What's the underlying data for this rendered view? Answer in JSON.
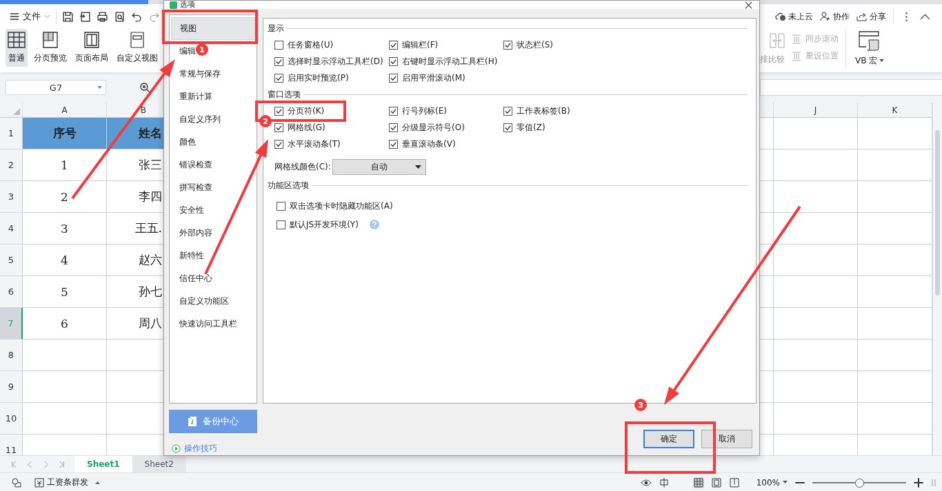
{
  "app": {
    "menu": "文件",
    "view_buttons": [
      {
        "label": "普通",
        "selected": true
      },
      {
        "label": "分页预览",
        "selected": false
      },
      {
        "label": "页面布局",
        "selected": false
      },
      {
        "label": "自定义视图",
        "selected": false
      }
    ],
    "right_actions": [
      {
        "label": "未上云"
      },
      {
        "label": "协作"
      },
      {
        "label": "分享"
      }
    ],
    "compare": "排比较",
    "sync_items": [
      {
        "label": "同步滚动",
        "disabled": true
      },
      {
        "label": "重设位置",
        "disabled": true
      }
    ],
    "macro": "VB 宏"
  },
  "formula_bar": {
    "name_box": "G7"
  },
  "sheet": {
    "left_columns": [
      "A",
      "B"
    ],
    "right_columns": [
      "J",
      "K"
    ],
    "rows": [
      {
        "number": "1",
        "selected": false,
        "kind": "header",
        "cells": [
          "序号",
          "姓名"
        ]
      },
      {
        "number": "2",
        "selected": false,
        "kind": "data",
        "cells": [
          "1",
          "张三"
        ]
      },
      {
        "number": "3",
        "selected": false,
        "kind": "data",
        "cells": [
          "2",
          "李四"
        ]
      },
      {
        "number": "4",
        "selected": false,
        "kind": "data",
        "cells": [
          "3",
          "王五."
        ]
      },
      {
        "number": "5",
        "selected": false,
        "kind": "data",
        "cells": [
          "4",
          "赵六"
        ]
      },
      {
        "number": "6",
        "selected": false,
        "kind": "data",
        "cells": [
          "5",
          "孙七"
        ]
      },
      {
        "number": "7",
        "selected": true,
        "kind": "data",
        "cells": [
          "6",
          "周八"
        ]
      },
      {
        "number": "8",
        "selected": false,
        "kind": "empty"
      },
      {
        "number": "9",
        "selected": false,
        "kind": "empty"
      },
      {
        "number": "10",
        "selected": false,
        "kind": "empty"
      },
      {
        "number": "11",
        "selected": false,
        "kind": "empty"
      }
    ]
  },
  "sheet_tabs": [
    {
      "label": "Sheet1",
      "selected": true
    },
    {
      "label": "Sheet2",
      "selected": false
    }
  ],
  "status_bar": {
    "label": "工资条群发",
    "zoom": "100%",
    "level": 0.5
  },
  "dialog": {
    "title": "选项",
    "nav": [
      {
        "label": "视图",
        "selected": true
      },
      {
        "label": "编辑",
        "selected": false
      },
      {
        "label": "常规与保存",
        "selected": false
      },
      {
        "label": "重新计算",
        "selected": false
      },
      {
        "label": "自定义序列",
        "selected": false
      },
      {
        "label": "颜色",
        "selected": false
      },
      {
        "label": "错误检查",
        "selected": false
      },
      {
        "label": "拼写检查",
        "selected": false
      },
      {
        "label": "安全性",
        "selected": false
      },
      {
        "label": "外部内容",
        "selected": false
      },
      {
        "label": "新特性",
        "selected": false
      },
      {
        "label": "信任中心",
        "selected": false
      },
      {
        "label": "自定义功能区",
        "selected": false
      },
      {
        "label": "快速访问工具栏",
        "selected": false
      }
    ],
    "backup_button": "备份中心",
    "tips_link": "操作技巧",
    "sections": [
      {
        "title": "显示",
        "rows": [
          [
            {
              "label": "任务窗格(U)",
              "checked": false,
              "help": false
            },
            {
              "label": "编辑栏(F)",
              "checked": true,
              "help": false
            },
            {
              "label": "状态栏(S)",
              "checked": true,
              "help": false
            }
          ],
          [
            {
              "label": "选择时显示浮动工具栏(D)",
              "checked": true,
              "help": false
            },
            {
              "label": "右键时显示浮动工具栏(H)",
              "checked": true,
              "help": false
            }
          ],
          [
            {
              "label": "启用实时预览(P)",
              "checked": true,
              "help": false
            },
            {
              "label": "启用平滑滚动(M)",
              "checked": true,
              "help": false
            }
          ]
        ]
      },
      {
        "title": "窗口选项",
        "rows": [
          [
            {
              "label": "分页符(K)",
              "checked": true,
              "help": false
            },
            {
              "label": "行号列标(E)",
              "checked": true,
              "help": false
            },
            {
              "label": "工作表标签(B)",
              "checked": true,
              "help": false
            }
          ],
          [
            {
              "label": "网格线(G)",
              "checked": true,
              "help": false
            },
            {
              "label": "分级显示符号(O)",
              "checked": true,
              "help": false
            },
            {
              "label": "零值(Z)",
              "checked": true,
              "help": false
            }
          ],
          [
            {
              "label": "水平滚动条(T)",
              "checked": true,
              "help": false
            },
            {
              "label": "垂直滚动条(V)",
              "checked": true,
              "help": false
            }
          ]
        ],
        "color_field": {
          "label": "网格线颜色(C):",
          "value": "自动"
        }
      },
      {
        "title": "功能区选项",
        "rows": [
          [
            {
              "label": "双击选项卡时隐藏功能区(A)",
              "checked": false,
              "help": false
            }
          ],
          [
            {
              "label": "默认JS开发环境(Y)",
              "checked": false,
              "help": true
            }
          ]
        ]
      }
    ],
    "buttons": [
      {
        "label": "确定",
        "selected": true
      },
      {
        "label": "取消",
        "selected": false
      }
    ]
  },
  "annotations": [
    {
      "number": "1"
    },
    {
      "number": "2"
    },
    {
      "number": "3"
    }
  ]
}
